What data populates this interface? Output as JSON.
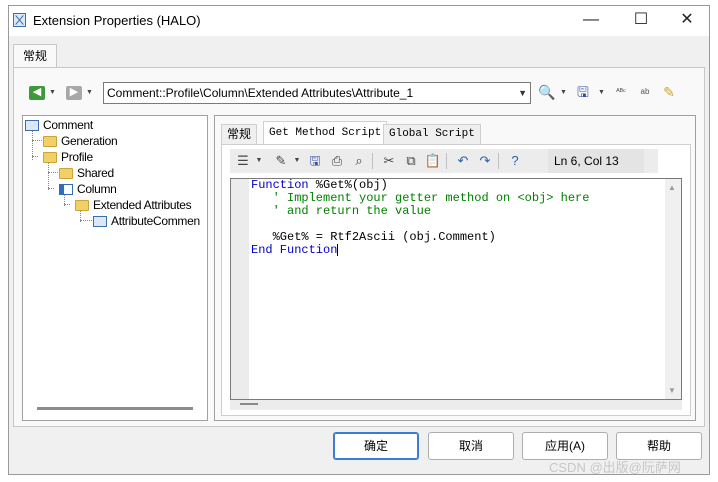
{
  "window": {
    "title": "Extension Properties (HALO)",
    "minimize": "—",
    "maximize": "☐",
    "close": "✕"
  },
  "main_tab": "常规",
  "toolbar": {
    "path": "Comment::Profile\\Column\\Extended Attributes\\Attribute_1",
    "icons": [
      "back-icon",
      "forward-icon",
      "find-icon",
      "save-icon",
      "spell-check-icon",
      "rename-icon",
      "properties-icon"
    ]
  },
  "tree": {
    "items": [
      {
        "label": "Comment",
        "icon": "comment-icon"
      },
      {
        "label": "Generation",
        "icon": "folder-icon"
      },
      {
        "label": "Profile",
        "icon": "folder-icon"
      },
      {
        "label": "Shared",
        "icon": "folder-icon"
      },
      {
        "label": "Column",
        "icon": "table-column-icon"
      },
      {
        "label": "Extended Attributes",
        "icon": "folder-icon"
      },
      {
        "label": "AttributeCommen",
        "icon": "attribute-icon"
      }
    ]
  },
  "subtabs": [
    "常规",
    "Get Method Script",
    "Global Script"
  ],
  "editor": {
    "status": "Ln 6, Col 13",
    "icons": [
      "list-icon",
      "edit-icon",
      "save-icon",
      "print-icon",
      "find-icon",
      "cut-icon",
      "copy-icon",
      "paste-icon",
      "undo-icon",
      "redo-icon",
      "help-icon"
    ],
    "code": {
      "l1_kw": "Function",
      "l1_tx": " %Get%(obj)",
      "l2": "   ' Implement your getter method on <obj> here",
      "l3": "   ' and return the value",
      "l5": "   %Get% = Rtf2Ascii (obj.Comment)",
      "l6_kw": "End Function"
    }
  },
  "buttons": {
    "ok": "确定",
    "cancel": "取消",
    "apply": "应用(A)",
    "help": "帮助"
  },
  "watermark": "CSDN @出版@阮萨网"
}
